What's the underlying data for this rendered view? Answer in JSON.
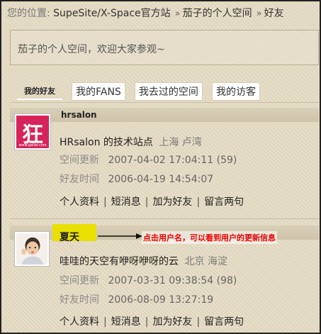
{
  "breadcrumb": {
    "label": "您的位置:",
    "items": [
      "SupeSite/X-Space官方站",
      "茄子的个人空间",
      "好友"
    ]
  },
  "intro": "茄子的个人空间，欢迎大家参观~",
  "tabs": [
    "我的好友",
    "我的FANS",
    "我去过的空间",
    "我的访客"
  ],
  "friends": [
    {
      "username": "hrsalon",
      "avatar_glyph": "狂",
      "avatar_url": "www.galiar.com",
      "title": "HRsalon 的技术站点",
      "location": "上海  卢湾",
      "space_update_label": "空间更新",
      "space_update": "2007-04-02 17:04:11",
      "space_update_count": "(59)",
      "friend_time_label": "好友时间",
      "friend_time": "2006-04-19 14:54:07",
      "actions": [
        "个人资料",
        "短消息",
        "加为好友",
        "留言两句"
      ]
    },
    {
      "username": "夏天",
      "title": "哇哇的天空有咿呀咿呀的云",
      "location": "北京  海淀",
      "space_update_label": "空间更新",
      "space_update": "2007-03-31 09:38:54",
      "space_update_count": "(98)",
      "friend_time_label": "好友时间",
      "friend_time": "2006-08-09 13:27:19",
      "actions": [
        "个人资料",
        "短消息",
        "加为好友",
        "留言两句"
      ]
    }
  ],
  "annotation": "点击用户名，可以看到用户的更新信息",
  "colors": {
    "highlight": "#e8e000",
    "annotation": "#ee0000",
    "avatar_brand": "#d6245b"
  }
}
